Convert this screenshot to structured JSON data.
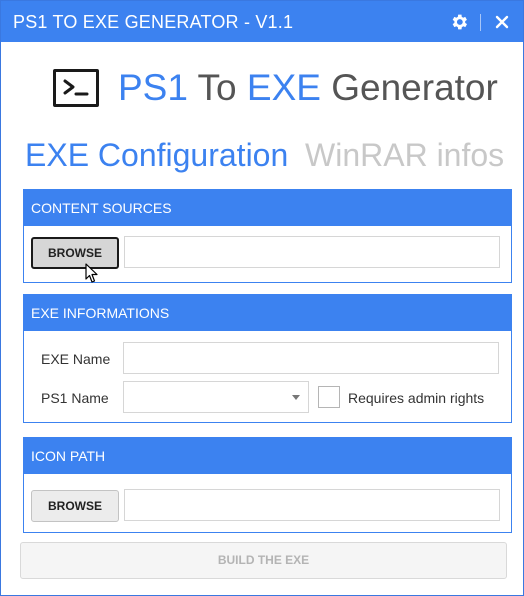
{
  "window": {
    "title": "PS1 TO EXE GENERATOR - V1.1"
  },
  "titlebar": {
    "settings_icon": "gear-icon",
    "close_icon": "close-icon"
  },
  "header": {
    "logo_icon": "terminal-prompt-icon",
    "title_part1": "PS1",
    "title_part2": " To ",
    "title_part3": "EXE",
    "title_part4": " Generator"
  },
  "tabs": [
    {
      "label": "EXE Configuration",
      "active": true
    },
    {
      "label": "WinRAR infos",
      "active": false
    }
  ],
  "content_sources": {
    "header": "CONTENT SOURCES",
    "browse_label": "BROWSE",
    "path_value": ""
  },
  "exe_informations": {
    "header": "EXE INFORMATIONS",
    "exe_name_label": "EXE Name",
    "exe_name_value": "",
    "ps1_name_label": "PS1 Name",
    "ps1_name_value": "",
    "admin_label": "Requires admin rights",
    "admin_checked": false
  },
  "icon_path": {
    "header": "ICON PATH",
    "browse_label": "BROWSE",
    "path_value": ""
  },
  "build": {
    "label": "BUILD THE EXE",
    "enabled": false
  },
  "colors": {
    "accent": "#3c82f0",
    "inactive_tab": "#c8c8c8",
    "disabled_text": "#b4b4b4"
  }
}
